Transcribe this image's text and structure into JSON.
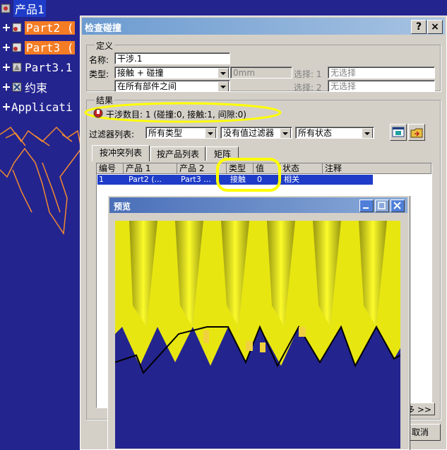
{
  "tree": {
    "items": [
      {
        "label": "产品1"
      },
      {
        "label": "Part2 ("
      },
      {
        "label": "Part3 ("
      },
      {
        "label": "Part3.1"
      },
      {
        "label": "约束"
      },
      {
        "label": "Applicati"
      }
    ]
  },
  "dialog": {
    "title": "检查碰撞",
    "help_label": "?",
    "close_label": "×",
    "definition": {
      "group_label": "定义",
      "name_label": "名称:",
      "name_value": "干涉.1",
      "type_label": "类型:",
      "type_value": "接触 + 碰撞",
      "scope_value": "在所有部件之间",
      "clearance_value": "0mm",
      "select1_label": "选择: 1",
      "select1_value": "无选择",
      "select2_label": "选择: 2",
      "select2_value": "无选择"
    },
    "results": {
      "group_label": "结果",
      "summary": "干涉数目: 1 (碰撞:0, 接触:1, 间隙:0)",
      "filter_label": "过滤器列表:",
      "filter1_value": "所有类型",
      "filter2_value": "没有值过滤器",
      "filter3_value": "所有状态"
    },
    "tabs": [
      {
        "label": "按冲突列表"
      },
      {
        "label": "按产品列表"
      },
      {
        "label": "矩阵"
      }
    ],
    "table": {
      "columns": [
        "编号",
        "产品 1",
        "产品 2",
        "类型",
        "值",
        "状态",
        "注释"
      ],
      "rows": [
        {
          "cells": [
            "1",
            "Part2 (...",
            "Part3 ...",
            "接触",
            "0",
            "相关",
            ""
          ]
        }
      ]
    },
    "more_label": "多 >>",
    "cancel_label": "取消"
  },
  "preview": {
    "title": "预览"
  },
  "colors": {
    "title_bar": "#6c9bd0",
    "selection": "#1e3cc8",
    "highlight_yellow": "#ffff00",
    "tree_highlight": "#f47c24",
    "gear_yellow": "#e8e610",
    "gear_blue": "#24248f"
  }
}
